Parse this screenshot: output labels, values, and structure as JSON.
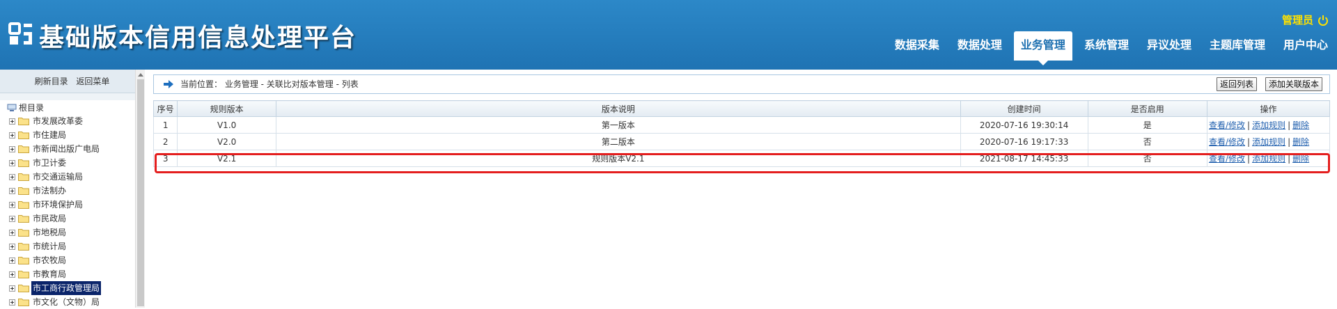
{
  "header": {
    "title": "基础版本信用信息处理平台",
    "user": "管理员",
    "nav": [
      {
        "label": "数据采集",
        "active": false
      },
      {
        "label": "数据处理",
        "active": false
      },
      {
        "label": "业务管理",
        "active": true
      },
      {
        "label": "系统管理",
        "active": false
      },
      {
        "label": "异议处理",
        "active": false
      },
      {
        "label": "主题库管理",
        "active": false
      },
      {
        "label": "用户中心",
        "active": false
      }
    ]
  },
  "sidebar": {
    "refresh": "刷新目录",
    "back_menu": "返回菜单",
    "root": "根目录",
    "items": [
      {
        "label": "市发展改革委"
      },
      {
        "label": "市住建局"
      },
      {
        "label": "市新闻出版广电局"
      },
      {
        "label": "市卫计委"
      },
      {
        "label": "市交通运输局"
      },
      {
        "label": "市法制办"
      },
      {
        "label": "市环境保护局"
      },
      {
        "label": "市民政局"
      },
      {
        "label": "市地税局"
      },
      {
        "label": "市统计局"
      },
      {
        "label": "市农牧局"
      },
      {
        "label": "市教育局"
      },
      {
        "label": "市工商行政管理局",
        "selected": true
      },
      {
        "label": "市文化（文物）局"
      }
    ]
  },
  "breadcrumb": {
    "text": "当前位置： 业务管理 - 关联比对版本管理 - 列表",
    "back_list": "返回列表",
    "add_version": "添加关联版本"
  },
  "table": {
    "headers": [
      "序号",
      "规则版本",
      "版本说明",
      "创建时间",
      "是否启用",
      "操作"
    ],
    "rows": [
      {
        "no": "1",
        "version": "V1.0",
        "desc": "第一版本",
        "created": "2020-07-16 19:30:14",
        "enabled": "是"
      },
      {
        "no": "2",
        "version": "V2.0",
        "desc": "第二版本",
        "created": "2020-07-16 19:17:33",
        "enabled": "否"
      },
      {
        "no": "3",
        "version": "V2.1",
        "desc": "规则版本V2.1",
        "created": "2021-08-17 14:45:33",
        "enabled": "否"
      }
    ],
    "ops": {
      "view": "查看/修改",
      "add_rule": "添加规则",
      "delete": "删除",
      "separator": "|"
    }
  },
  "colors": {
    "header_blue": "#1f73b3",
    "user_yellow": "#ffe100",
    "highlight_red": "#e41e1e",
    "link_blue": "#1f5fae"
  }
}
